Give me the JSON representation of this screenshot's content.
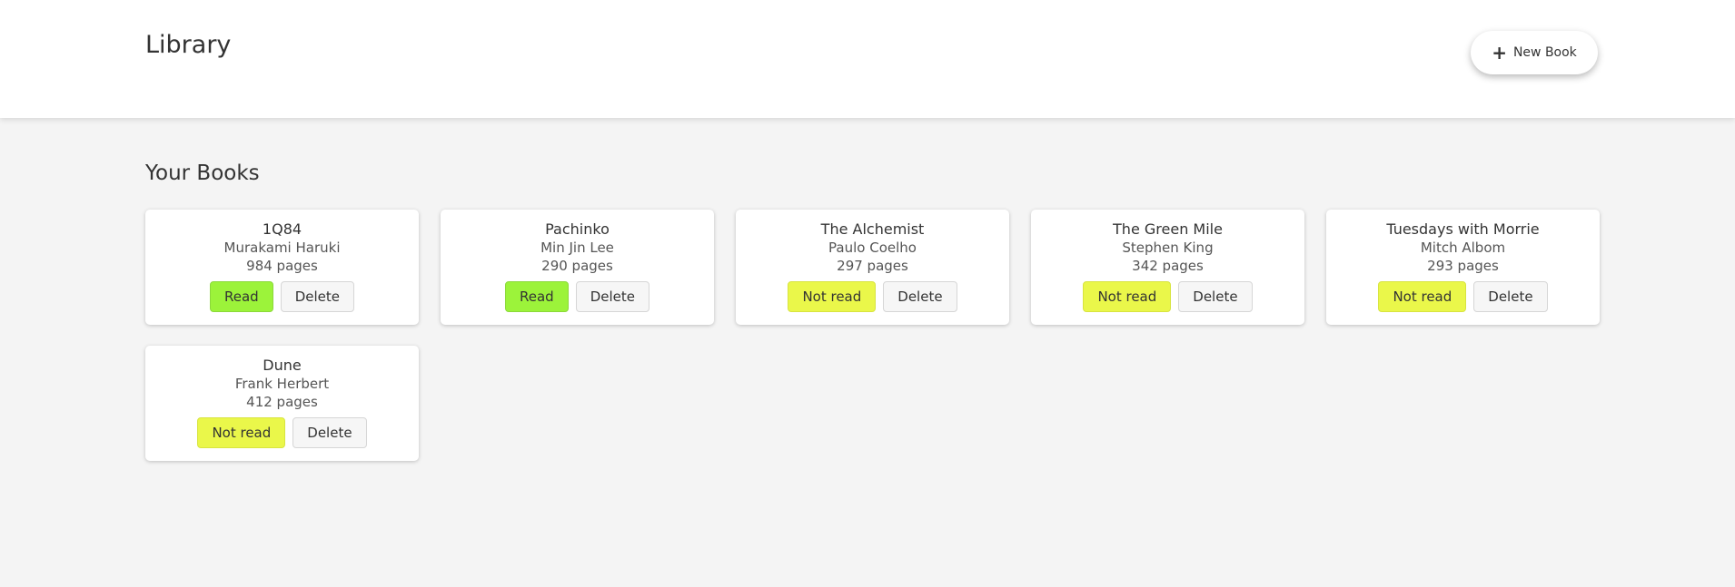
{
  "header": {
    "title": "Library",
    "new_book_label": "New Book",
    "new_book_icon": "plus-icon"
  },
  "main": {
    "section_title": "Your Books",
    "delete_label": "Delete",
    "colors": {
      "read": "#9cf33a",
      "not_read": "#eaf74a",
      "delete": "#f6f6f6"
    },
    "books": [
      {
        "title": "1Q84",
        "author": "Murakami Haruki",
        "pages": "984 pages",
        "status": "Read"
      },
      {
        "title": "Pachinko",
        "author": "Min Jin Lee",
        "pages": "290 pages",
        "status": "Read"
      },
      {
        "title": "The Alchemist",
        "author": "Paulo Coelho",
        "pages": "297 pages",
        "status": "Not read"
      },
      {
        "title": "The Green Mile",
        "author": "Stephen King",
        "pages": "342 pages",
        "status": "Not read"
      },
      {
        "title": "Tuesdays with Morrie",
        "author": "Mitch Albom",
        "pages": "293 pages",
        "status": "Not read"
      },
      {
        "title": "Dune",
        "author": "Frank Herbert",
        "pages": "412 pages",
        "status": "Not read"
      }
    ]
  }
}
